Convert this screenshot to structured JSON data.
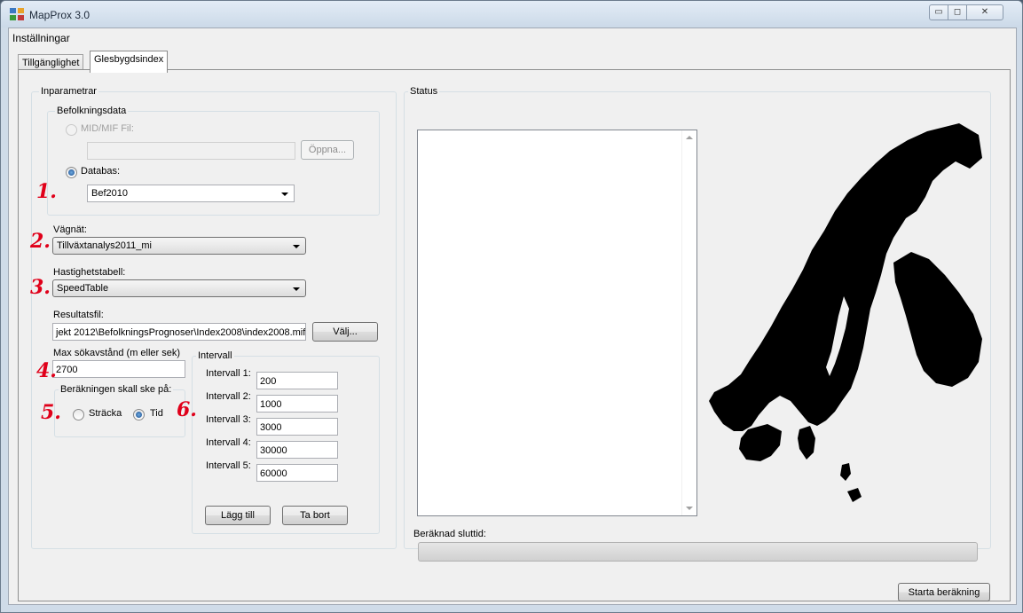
{
  "window": {
    "title": "MapProx 3.0"
  },
  "menu": {
    "settings": "Inställningar"
  },
  "tabs": [
    {
      "label": "Tillgänglighet"
    },
    {
      "label": "Glesbygdsindex"
    }
  ],
  "inparametrar": {
    "title": "Inparametrar",
    "befolkningsdata": {
      "title": "Befolkningsdata",
      "midmif_label": "MID/MIF Fil:",
      "midmif_value": "",
      "open_button": "Öppna...",
      "database_label": "Databas:",
      "database_value": "Bef2010"
    },
    "vagnat_label": "Vägnät:",
    "vagnat_value": "Tillväxtanalys2011_mi",
    "hastighet_label": "Hastighetstabell:",
    "hastighet_value": "SpeedTable",
    "resultat_label": "Resultatsfil:",
    "resultat_value": "jekt 2012\\BefolkningsPrognoser\\Index2008\\index2008.mif",
    "choose_button": "Välj...",
    "max_label": "Max sökavstånd (m eller sek)",
    "max_value": "2700",
    "calc_group_title": "Beräkningen skall ske på:",
    "opt_distance": "Sträcka",
    "opt_time": "Tid",
    "interval": {
      "title": "Intervall",
      "rows": [
        {
          "label": "Intervall 1:",
          "value": "200"
        },
        {
          "label": "Intervall 2:",
          "value": "1000"
        },
        {
          "label": "Intervall 3:",
          "value": "3000"
        },
        {
          "label": "Intervall 4:",
          "value": "30000"
        },
        {
          "label": "Intervall 5:",
          "value": "60000"
        }
      ],
      "add_button": "Lägg till",
      "remove_button": "Ta bort"
    }
  },
  "status": {
    "title": "Status",
    "text": ""
  },
  "end_time_label": "Beräknad sluttid:",
  "progress": {
    "fraction": 0
  },
  "start_button": "Starta beräkning",
  "annotations": [
    "1.",
    "2.",
    "3.",
    "4.",
    "5.",
    "6."
  ],
  "icons": {
    "app": "app-icon",
    "minimize": "minimize-icon",
    "maximize": "maximize-icon",
    "close": "close-icon"
  }
}
